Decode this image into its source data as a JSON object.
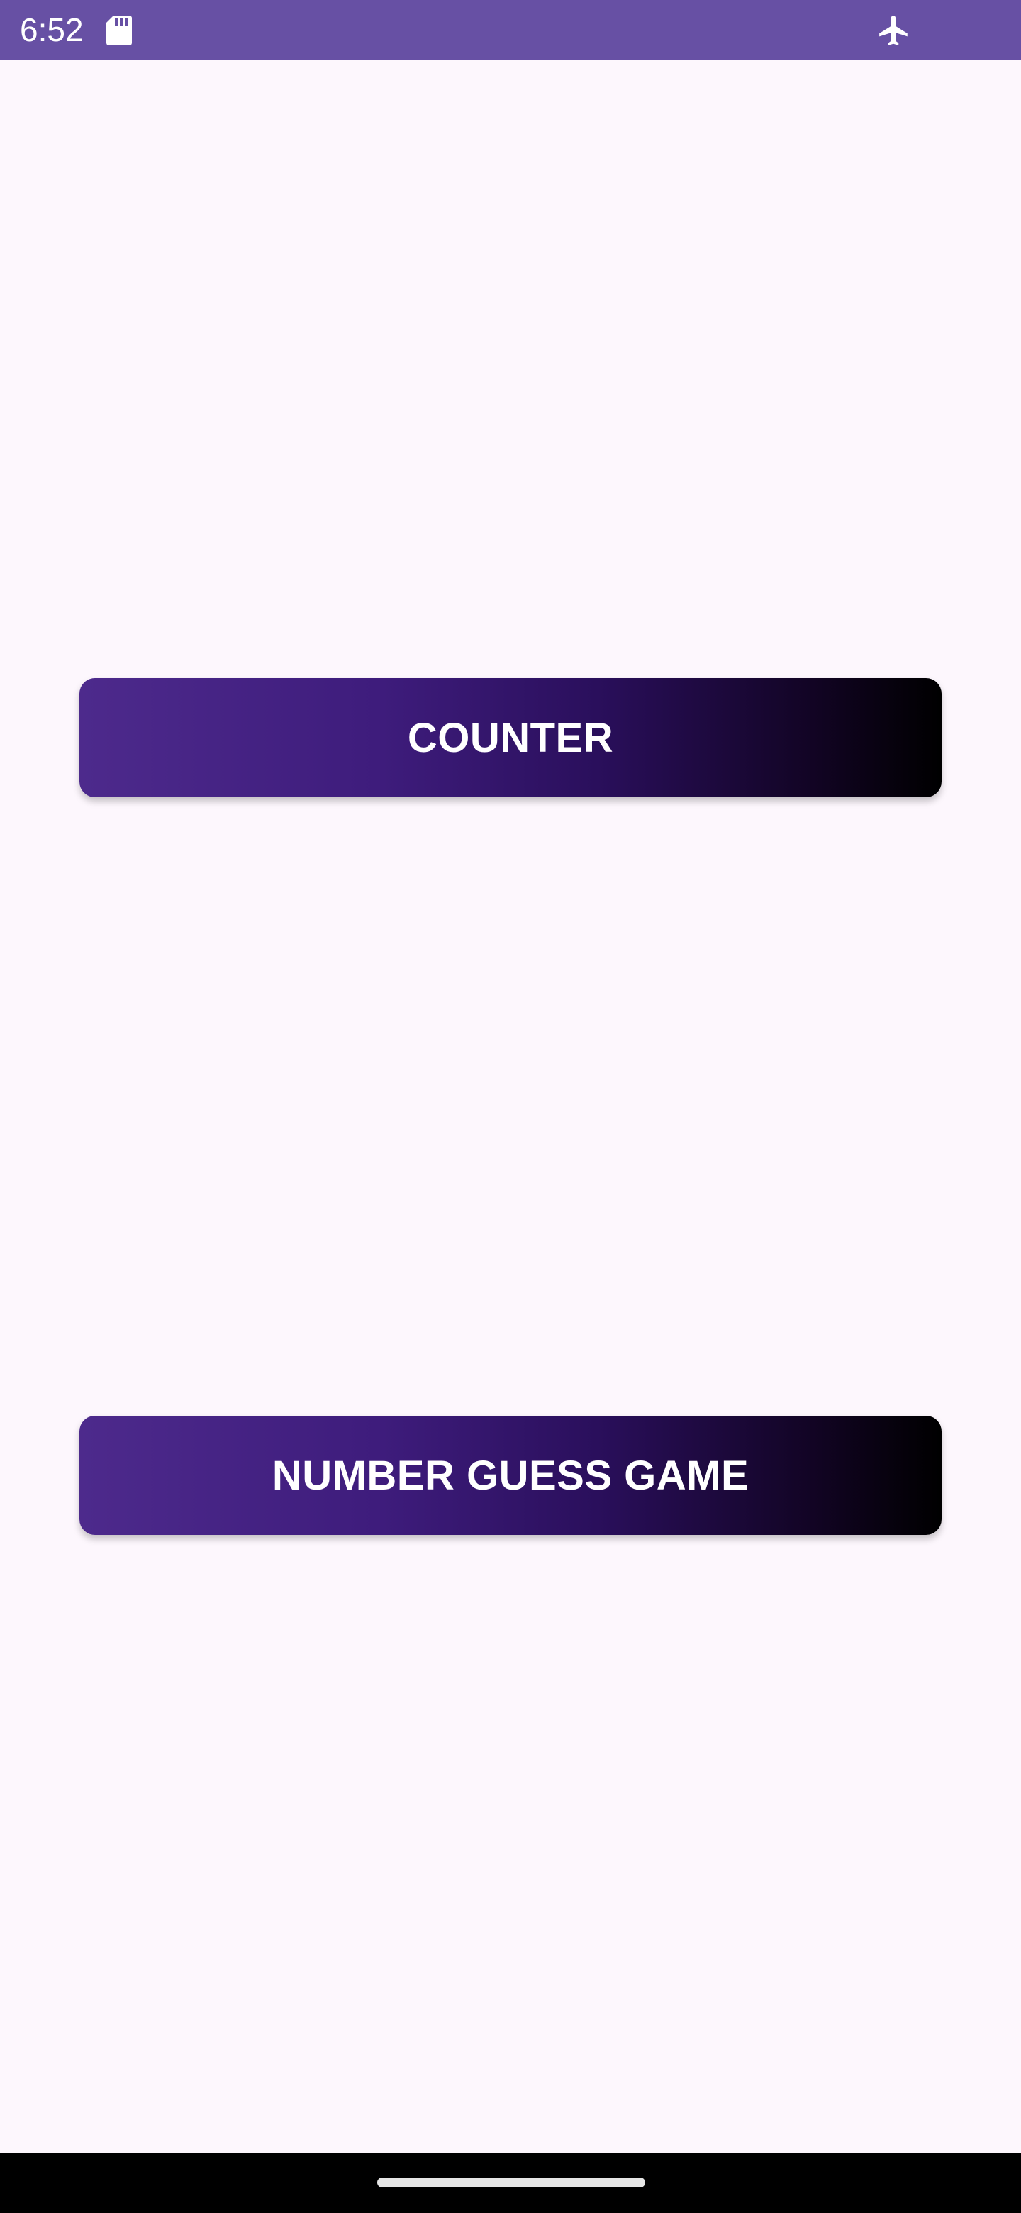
{
  "status_bar": {
    "time": "6:52",
    "icons": [
      "sd-card-icon",
      "airplane-mode-icon"
    ],
    "background_color": "#6750a4"
  },
  "main": {
    "buttons": [
      {
        "label": "COUNTER"
      },
      {
        "label": "NUMBER GUESS GAME"
      }
    ],
    "button_gradient_colors": [
      "#4d2a8c",
      "#2a0f5c",
      "#000000"
    ],
    "background_color": "#fdf7fd"
  },
  "navigation_bar": {
    "type": "gesture-handle",
    "background_color": "#000000"
  }
}
